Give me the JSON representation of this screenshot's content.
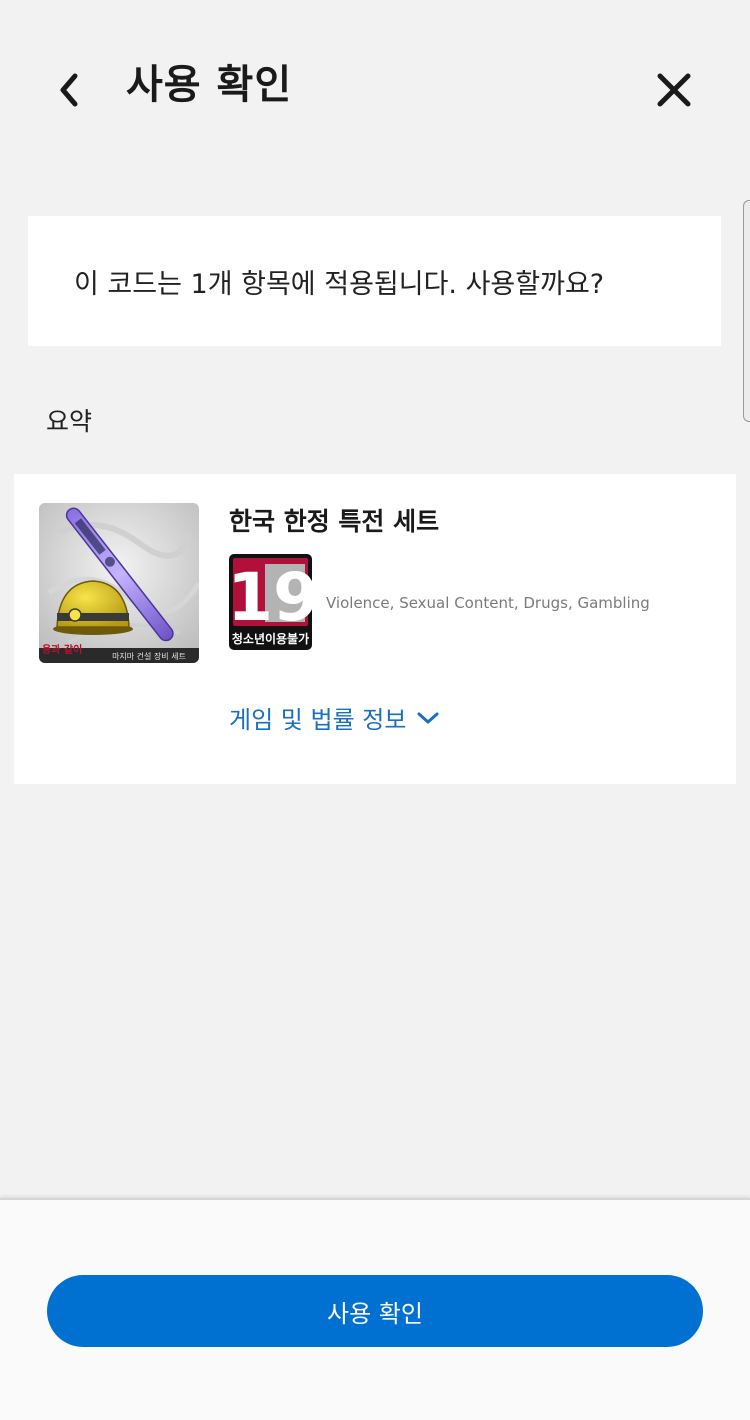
{
  "header": {
    "title": "사용 확인",
    "back_icon": "chevron-left-icon",
    "close_icon": "close-icon"
  },
  "message": {
    "text": "이 코드는 1개 항목에 적용됩니다. 사용할까요?"
  },
  "summary": {
    "label": "요약"
  },
  "product": {
    "title": "한국 한정 특전 세트",
    "thumbnail_caption": "마지마 건설 장비 세트",
    "thumbnail_logo": "용과 같이",
    "rating": {
      "number": "19",
      "label": "청소년이용불가"
    },
    "descriptors": "Violence, Sexual Content, Drugs, Gambling",
    "legal_link": "게임 및 법률 정보"
  },
  "footer": {
    "confirm_label": "사용 확인"
  },
  "colors": {
    "accent": "#0070d1",
    "link": "#1a6fc2",
    "background": "#f2f2f2",
    "rating_red": "#b0103a"
  }
}
